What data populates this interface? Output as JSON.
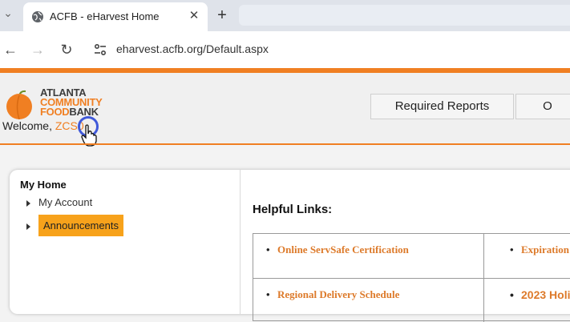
{
  "browser": {
    "tab_title": "ACFB - eHarvest Home",
    "tab_close": "✕",
    "new_tab": "+",
    "url": "eharvest.acfb.org/Default.aspx",
    "icons": [
      "globe-icon",
      "close-icon",
      "plus-icon",
      "back-arrow-icon",
      "forward-arrow-icon",
      "reload-icon",
      "site-info-icon"
    ]
  },
  "header": {
    "logo_line1": "ATLANTA",
    "logo_line2": "COMMUNITY",
    "logo_line3": "FOOD",
    "logo_line3b": "BANK",
    "welcome_label": "Welcome,",
    "welcome_user": "ZCS0",
    "nav": [
      "Required Reports",
      "O"
    ],
    "accent_color": "#f07f22"
  },
  "sidebar": {
    "title": "My Home",
    "items": [
      {
        "label": "My Account"
      },
      {
        "label": "Announcements",
        "selected": true
      }
    ]
  },
  "main": {
    "helpful_title": "Helpful Links:",
    "links": [
      "Online ServSafe Certification",
      "Expiration",
      "Regional Delivery Schedule",
      "2023 Holi"
    ]
  }
}
